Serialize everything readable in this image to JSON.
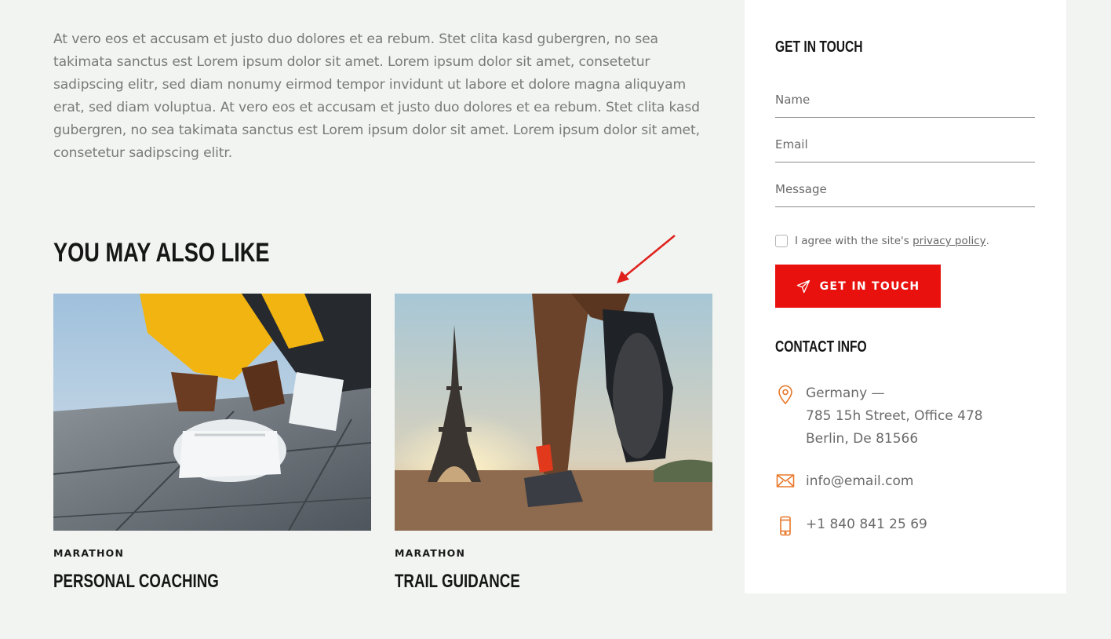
{
  "intro": {
    "text": "At vero eos et accusam et justo duo dolores et ea rebum. Stet clita kasd gubergren, no sea takimata sanctus est Lorem ipsum dolor sit amet. Lorem ipsum dolor sit amet, consetetur sadipscing elitr, sed diam nonumy eirmod tempor invidunt ut labore et dolore magna aliquyam erat, sed diam voluptua. At vero eos et accusam et justo duo dolores et ea rebum. Stet clita kasd gubergren, no sea takimata sanctus est Lorem ipsum dolor sit amet. Lorem ipsum dolor sit amet, consetetur sadipscing elitr."
  },
  "related": {
    "title": "YOU MAY ALSO LIKE",
    "cards": [
      {
        "category": "MARATHON",
        "title": "PERSONAL COACHING"
      },
      {
        "category": "MARATHON",
        "title": "TRAIL GUIDANCE"
      }
    ]
  },
  "contact_form": {
    "title": "GET IN TOUCH",
    "name_placeholder": "Name",
    "email_placeholder": "Email",
    "message_placeholder": "Message",
    "agree_text": "I agree with the site's ",
    "privacy_link": "privacy policy",
    "agree_suffix": ".",
    "submit_label": "GET IN TOUCH"
  },
  "contact_info": {
    "title": "CONTACT INFO",
    "address_line1": "Germany —",
    "address_line2": "785 15h Street, Office 478",
    "address_line3": "Berlin, De 81566",
    "email": "info@email.com",
    "phone": "+1 840 841 25 69"
  },
  "colors": {
    "accent_red": "#e8110d",
    "icon_orange": "#e8782a",
    "page_bg": "#f1f4f1"
  },
  "icons": {
    "submit": "paper-plane-icon",
    "address": "map-pin-icon",
    "email": "envelope-icon",
    "phone": "mobile-phone-icon"
  }
}
